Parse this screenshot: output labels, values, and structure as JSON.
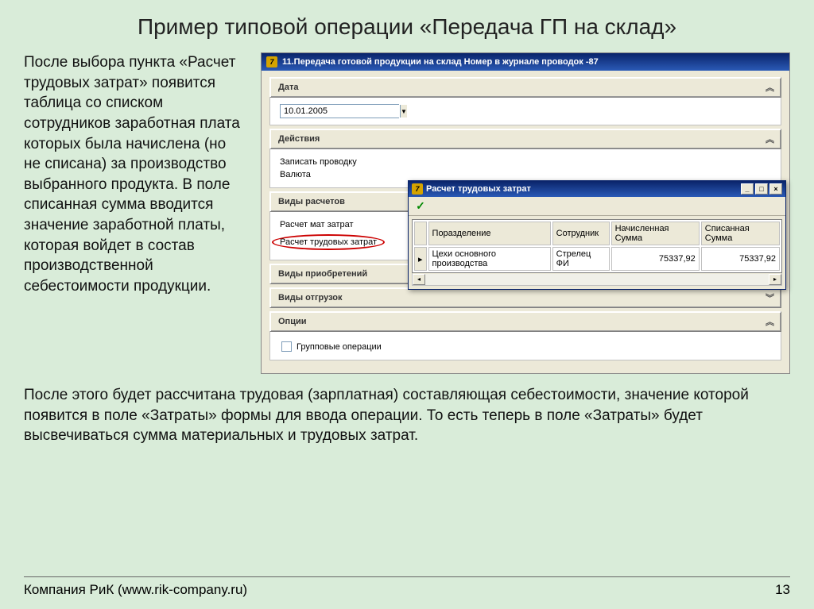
{
  "slide": {
    "title": "Пример типовой операции «Передача ГП на склад»",
    "left_paragraph": "После выбора пункта «Расчет трудовых затрат» появится таблица со списком сотрудников заработная плата которых была начислена (но не списана) за производство выбранного продукта. В поле списанная сумма вводится значение заработной платы, которая войдет в состав производственной себестоимости продукции.",
    "bottom_paragraph": "После этого будет рассчитана трудовая (зарплатная) составляющая себестоимости, значение которой появится в поле «Затраты» формы для ввода операции. То есть теперь в поле «Затраты» будет высвечиваться сумма материальных и трудовых затрат.",
    "footer_company": "Компания РиК (www.rik-company.ru)",
    "footer_page": "13"
  },
  "app": {
    "title": "11.Передача готовой продукции на склад     Номер в журнале проводок -87",
    "sections": {
      "date_label": "Дата",
      "date_value": "10.01.2005",
      "actions_label": "Действия",
      "actions": {
        "write": "Записать проводку",
        "currency": "Валюта"
      },
      "calc_types_label": "Виды расчетов",
      "calc_types": {
        "material": "Расчет мат затрат",
        "labor": "Расчет трудовых затрат"
      },
      "acq_types_label": "Виды приобретений",
      "ship_types_label": "Виды отгрузок",
      "options_label": "Опции",
      "group_ops": "Групповые операции"
    }
  },
  "popup": {
    "title": "Расчет трудовых затрат",
    "columns": {
      "dept": "Поразделение",
      "emp": "Сотрудник",
      "accrued": "Начисленная Сумма",
      "written": "Списанная Сумма"
    },
    "row": {
      "dept": "Цехи основного производства",
      "emp": "Стрелец ФИ",
      "accrued": "75337,92",
      "written": "75337,92"
    }
  }
}
